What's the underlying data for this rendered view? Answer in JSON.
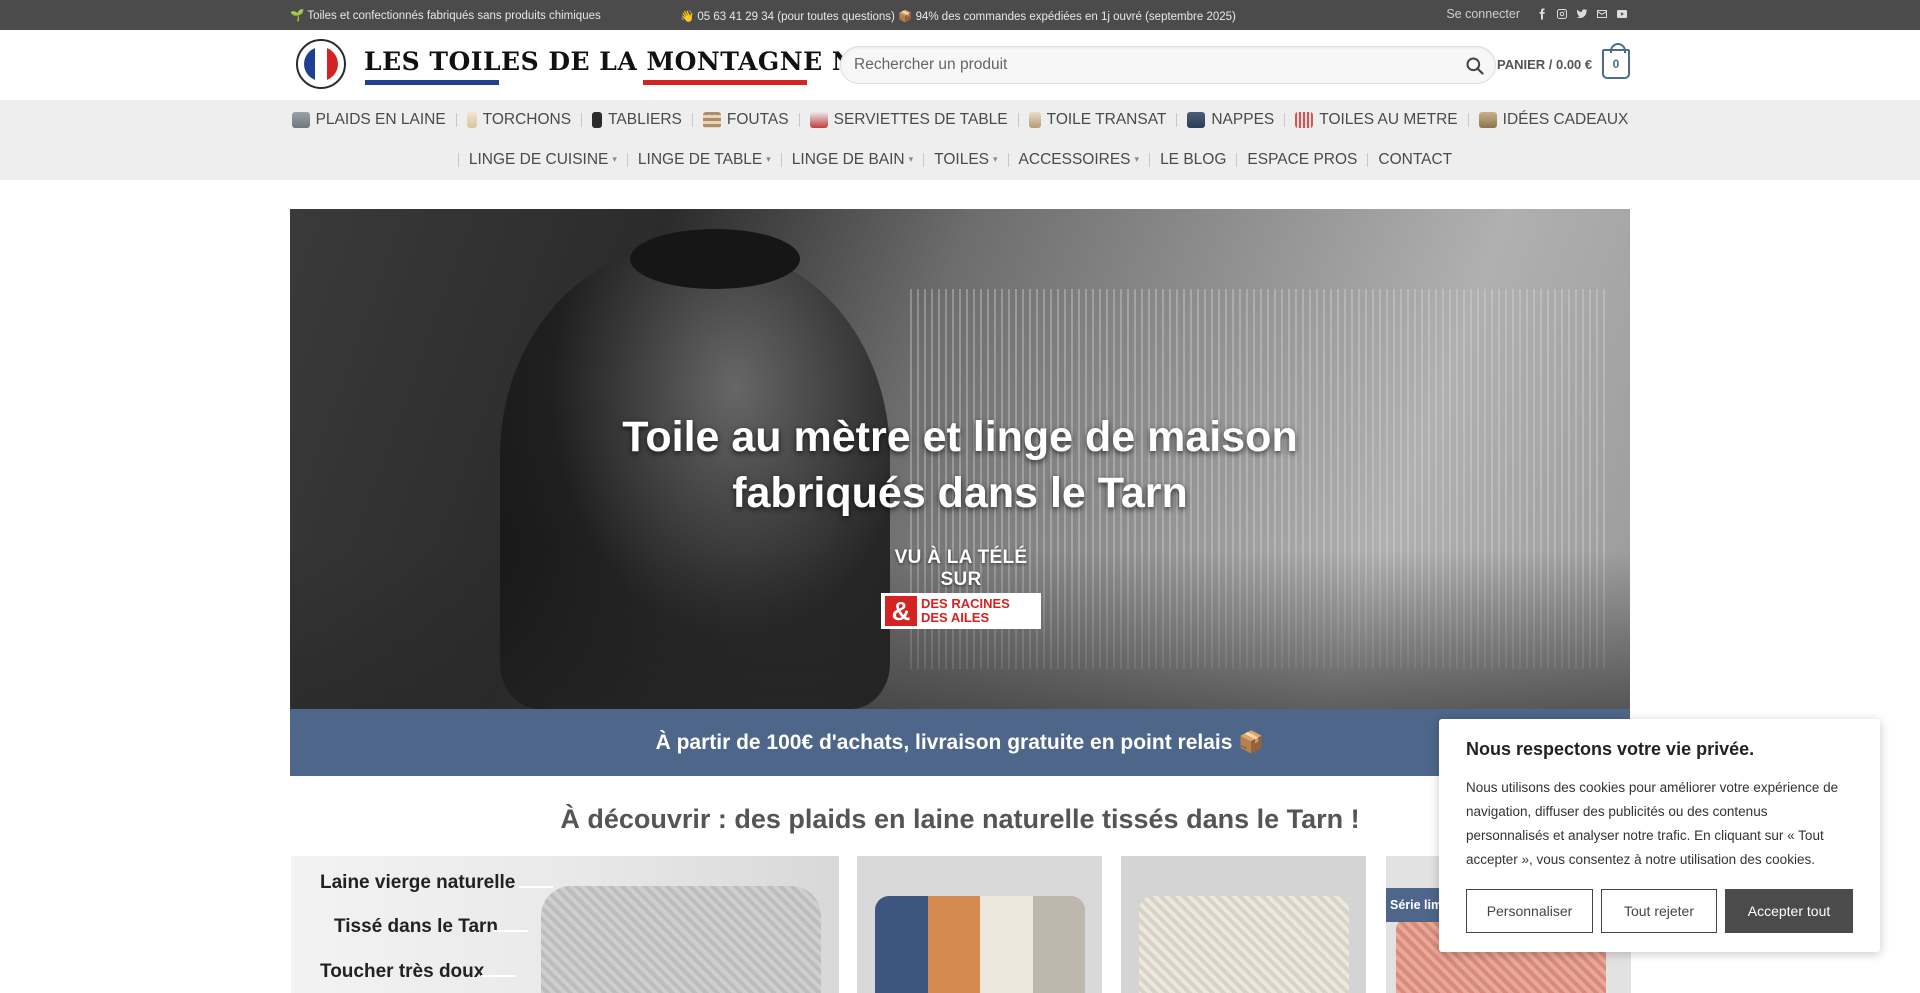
{
  "topbar": {
    "left_text": "Toiles et confectionnés fabriqués sans produits chimiques",
    "center_text": "05 63 41 29 34 (pour toutes questions) 📦 94% des commandes expédiées en 1j ouvré (septembre 2025)",
    "login": "Se connecter",
    "social_icons": [
      "facebook-icon",
      "instagram-icon",
      "twitter-icon",
      "email-icon",
      "youtube-icon"
    ]
  },
  "header": {
    "logo_text": "LES TOILES DE LA MONTAGNE NOIRE",
    "search_placeholder": "Rechercher un produit",
    "cart_label": "PANIER / 0.00 €",
    "cart_count": "0"
  },
  "nav": {
    "row1": [
      {
        "label": "PLAIDS EN LAINE",
        "icon": "blanket-icon"
      },
      {
        "label": "TORCHONS",
        "icon": "towel-icon"
      },
      {
        "label": "TABLIERS",
        "icon": "apron-icon"
      },
      {
        "label": "FOUTAS",
        "icon": "fouta-icon"
      },
      {
        "label": "SERVIETTES DE TABLE",
        "icon": "napkin-icon"
      },
      {
        "label": "TOILE TRANSAT",
        "icon": "deckchair-icon"
      },
      {
        "label": "NAPPES",
        "icon": "tablecloth-icon"
      },
      {
        "label": "TOILES AU METRE",
        "icon": "fabric-roll-icon"
      },
      {
        "label": "IDÉES CADEAUX",
        "icon": "gift-icon"
      }
    ],
    "row2": [
      {
        "label": "LINGE DE CUISINE",
        "dropdown": true
      },
      {
        "label": "LINGE DE TABLE",
        "dropdown": true
      },
      {
        "label": "LINGE DE BAIN",
        "dropdown": true
      },
      {
        "label": "TOILES",
        "dropdown": true
      },
      {
        "label": "ACCESSOIRES",
        "dropdown": true
      },
      {
        "label": "LE BLOG",
        "dropdown": false
      },
      {
        "label": "ESPACE PROS",
        "dropdown": false
      },
      {
        "label": "CONTACT",
        "dropdown": false
      }
    ]
  },
  "hero": {
    "title": "Toile au mètre et linge de maison fabriqués dans le Tarn",
    "badge_top": "VU À LA TÉLÉ SUR",
    "badge_amp": "&",
    "badge_line1": "DES RACINES",
    "badge_line2": "DES AILES"
  },
  "promo": {
    "text": "À partir de 100€ d'achats, livraison gratuite en point relais 📦"
  },
  "discover": {
    "title": "À découvrir : des plaids en laine naturelle tissés dans le Tarn !"
  },
  "products": {
    "feature_lines": [
      "Laine vierge naturelle",
      "Tissé dans le Tarn",
      "Toucher très doux"
    ],
    "badge": "Série limi"
  },
  "cookie": {
    "title": "Nous respectons votre vie privée.",
    "text": "Nous utilisons des cookies pour améliorer votre expérience de navigation, diffuser des publicités ou des contenus personnalisés et analyser notre trafic. En cliquant sur « Tout accepter », vous consentez à notre utilisation des cookies.",
    "btn_customize": "Personnaliser",
    "btn_reject": "Tout rejeter",
    "btn_accept": "Accepter tout"
  },
  "colors": {
    "topbar": "#4b4b4b",
    "accent_blue": "#4d6689",
    "nav_bg": "#eeeeee",
    "logo_blue": "#1f3f8f",
    "logo_red": "#d32323"
  }
}
